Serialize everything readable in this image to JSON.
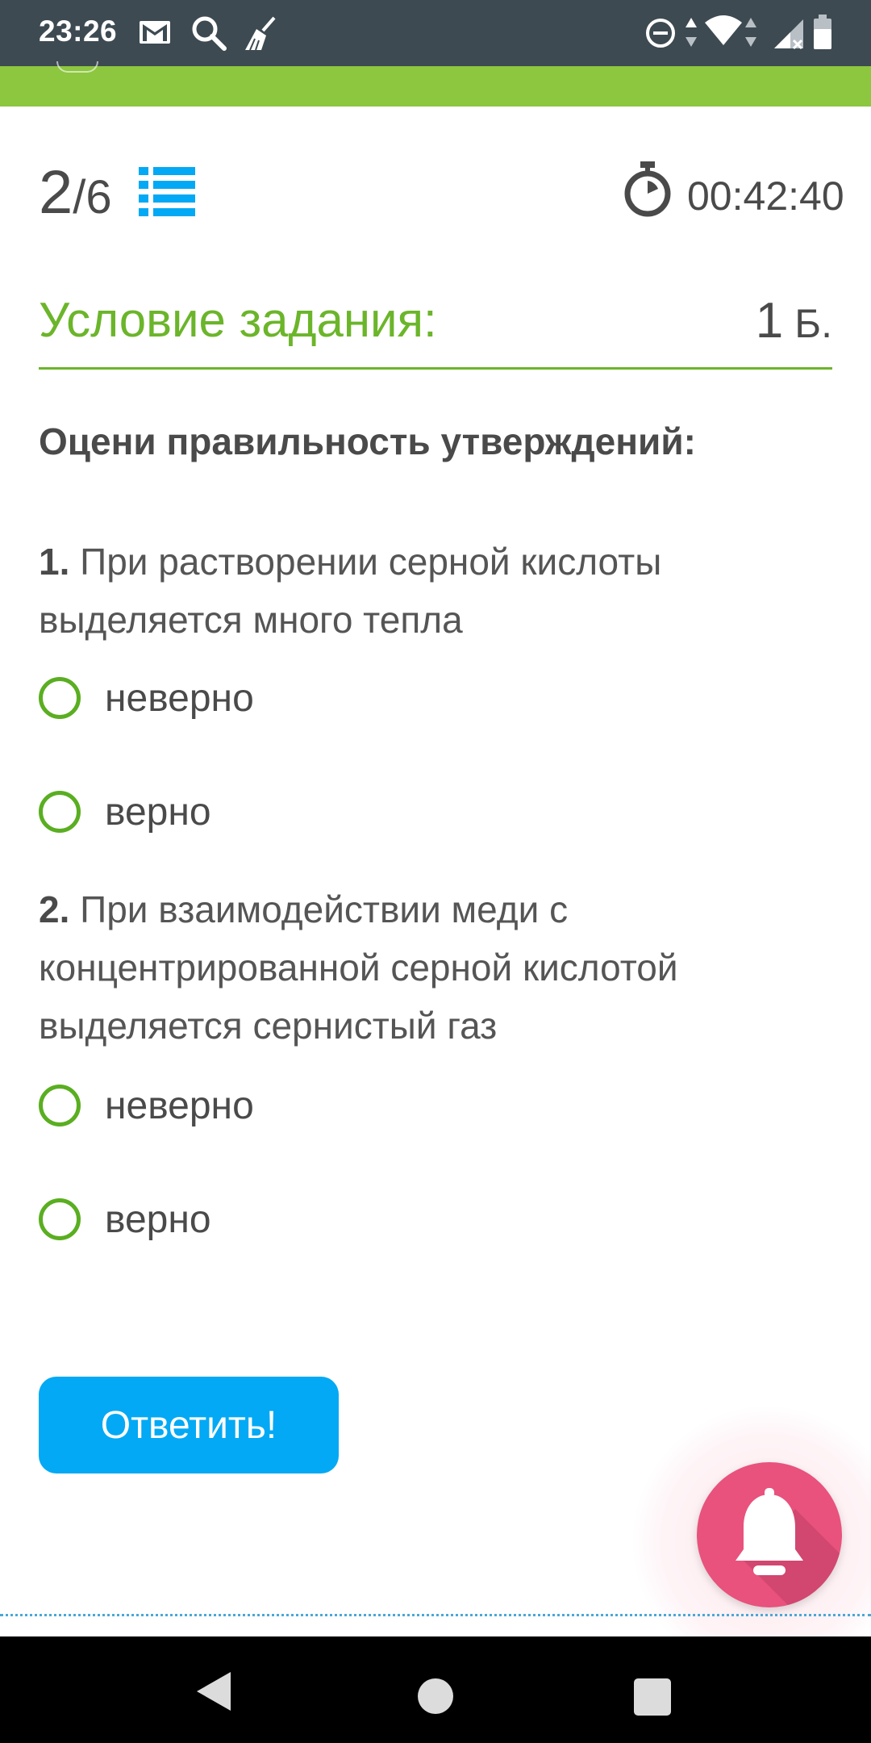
{
  "status_bar": {
    "time": "23:26",
    "left_icons": [
      "gmail-icon",
      "search-icon",
      "broom-icon"
    ],
    "right_icons": [
      "do-not-disturb-icon",
      "data-arrows-icon",
      "wifi-icon",
      "signal-icon",
      "battery-icon"
    ]
  },
  "header": {
    "current_question": "2",
    "separator": "/",
    "total_questions": "6",
    "list_icon": "list-icon",
    "timer_icon": "stopwatch-icon",
    "timer_value": "00:42:40"
  },
  "condition": {
    "title": "Условие задания:",
    "points": "1",
    "points_unit": "Б."
  },
  "instruction": "Оцени правильность утверждений:",
  "questions": [
    {
      "number": "1.",
      "text_line1": "При растворении серной кислоты",
      "text_line2": "выделяется много тепла",
      "options": [
        "неверно",
        "верно"
      ]
    },
    {
      "number": "2.",
      "text_line1": "При взаимодействии меди с",
      "text_line2": "концентрированной серной кислотой",
      "text_line3": "выделяется сернистый газ",
      "options": [
        "неверно",
        "верно"
      ]
    }
  ],
  "submit_button": "Ответить!",
  "fab_icon": "bell-icon",
  "colors": {
    "status_bar": "#3d4a52",
    "accent_green": "#6bb52a",
    "top_bar_green": "#8dc63f",
    "radio_green": "#5aae21",
    "button_blue": "#03a9f4",
    "fab_pink": "#e8527c"
  },
  "nav_bar": [
    "back-icon",
    "home-icon",
    "recents-icon"
  ]
}
